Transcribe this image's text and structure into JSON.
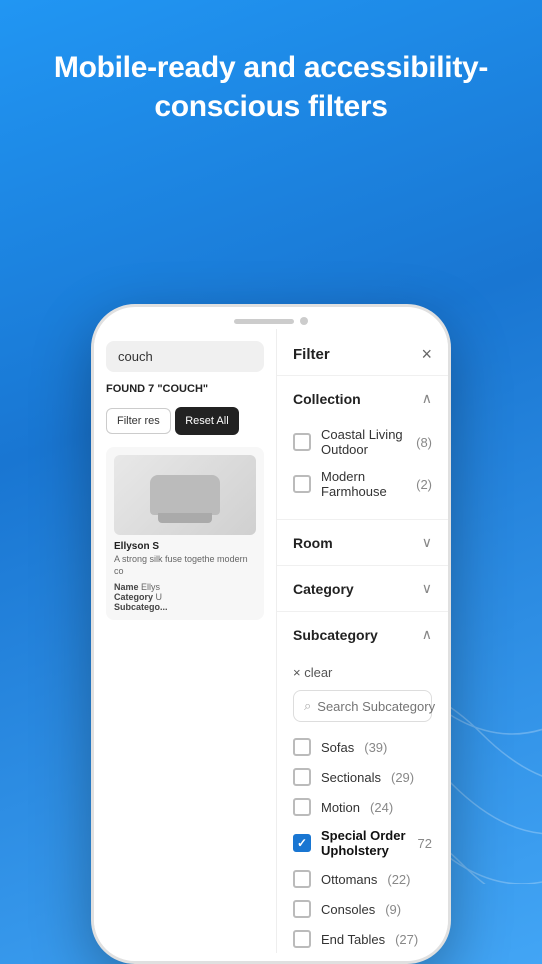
{
  "hero": {
    "title": "Mobile-ready and accessibility-conscious filters"
  },
  "left_panel": {
    "search_value": "couch",
    "found_text": "FOUND 7\n\"COUCH\"",
    "filter_results_label": "Filter res",
    "reset_label": "Reset All",
    "product": {
      "name": "Ellyson S",
      "desc": "A strong silk\nfuse togethe\nmodern co",
      "meta_name": "Ellys",
      "meta_category": "U",
      "meta_subcategory": "..."
    }
  },
  "filter_panel": {
    "title": "Filter",
    "close_label": "×",
    "sections": [
      {
        "id": "collection",
        "label": "Collection",
        "expanded": true,
        "options": [
          {
            "id": "coastal",
            "label": "Coastal Living Outdoor",
            "count": "(8)",
            "checked": false
          },
          {
            "id": "modern-farmhouse",
            "label": "Modern Farmhouse",
            "count": "(2)",
            "checked": false
          }
        ]
      },
      {
        "id": "room",
        "label": "Room",
        "expanded": false,
        "options": []
      },
      {
        "id": "category",
        "label": "Category",
        "expanded": false,
        "options": []
      },
      {
        "id": "subcategory",
        "label": "Subcategory",
        "expanded": true,
        "has_clear": true,
        "clear_label": "× clear",
        "search_placeholder": "Search Subcategory",
        "options": [
          {
            "id": "sofas",
            "label": "Sofas",
            "count": "(39)",
            "checked": false,
            "bold": false
          },
          {
            "id": "sectionals",
            "label": "Sectionals",
            "count": "(29)",
            "checked": false,
            "bold": false
          },
          {
            "id": "motion",
            "label": "Motion",
            "count": "(24)",
            "checked": false,
            "bold": false
          },
          {
            "id": "special-order",
            "label": "Special Order Upholstery",
            "count": "72",
            "checked": true,
            "bold": true
          },
          {
            "id": "ottomans",
            "label": "Ottomans",
            "count": "(22)",
            "checked": false,
            "bold": false
          },
          {
            "id": "consoles",
            "label": "Consoles",
            "count": "(9)",
            "checked": false,
            "bold": false
          },
          {
            "id": "end-tables",
            "label": "End Tables",
            "count": "(27)",
            "checked": false,
            "bold": false
          }
        ]
      }
    ]
  },
  "icons": {
    "chevron_up": "^",
    "chevron_down": "v",
    "close": "×",
    "search": "⌕",
    "check": "✓"
  }
}
